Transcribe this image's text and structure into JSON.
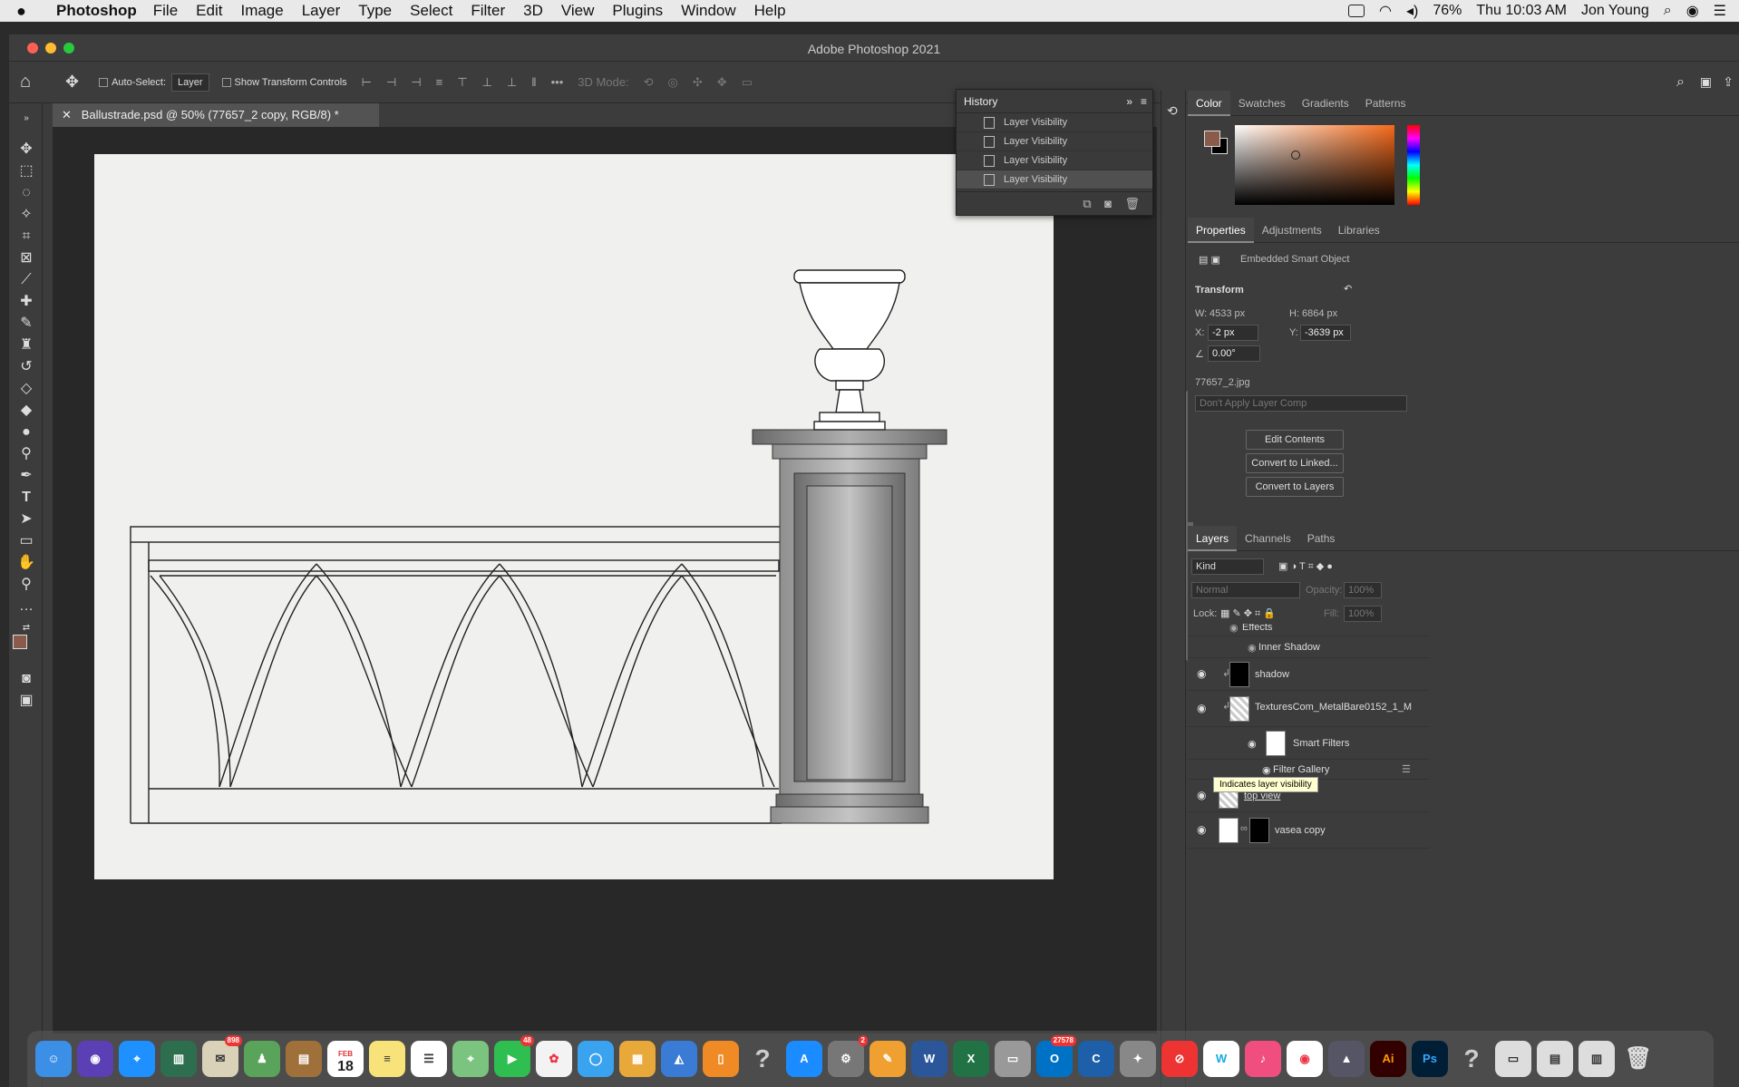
{
  "menubar": {
    "app_name": "Photoshop",
    "items": [
      "File",
      "Edit",
      "Image",
      "Layer",
      "Type",
      "Select",
      "Filter",
      "3D",
      "View",
      "Plugins",
      "Window",
      "Help"
    ],
    "battery": "76%",
    "clock": "Thu 10:03 AM",
    "user": "Jon Young"
  },
  "window": {
    "title": "Adobe Photoshop 2021"
  },
  "options": {
    "auto_select_label": "Auto-Select:",
    "auto_select_value": "Layer",
    "transform_label": "Show Transform Controls",
    "mode_label": "3D Mode:",
    "more": "•••"
  },
  "document": {
    "tab_title": "Ballustrade.psd @ 50% (77657_2 copy, RGB/8) *"
  },
  "history": {
    "title": "History",
    "items": [
      "Layer Visibility",
      "Layer Visibility",
      "Layer Visibility",
      "Layer Visibility"
    ]
  },
  "color_panel": {
    "tabs": [
      "Color",
      "Swatches",
      "Gradients",
      "Patterns"
    ],
    "foreground": "#8a5a4a",
    "background": "#000000"
  },
  "properties": {
    "tabs": [
      "Properties",
      "Adjustments",
      "Libraries"
    ],
    "type_label": "Embedded Smart Object",
    "transform_label": "Transform",
    "w_label": "W:",
    "w_value": "4533 px",
    "h_label": "H:",
    "h_value": "6864 px",
    "x_label": "X:",
    "x_value": "-2 px",
    "y_label": "Y:",
    "y_value": "-3639 px",
    "angle_value": "0.00°",
    "filename": "77657_2.jpg",
    "layer_comp": "Don't Apply Layer Comp",
    "buttons": [
      "Edit Contents",
      "Convert to Linked...",
      "Convert to Layers"
    ]
  },
  "layers_panel": {
    "tabs": [
      "Layers",
      "Channels",
      "Paths"
    ],
    "kind_label": "Kind",
    "blend_mode": "Normal",
    "opacity_label": "Opacity:",
    "opacity_value": "100%",
    "lock_label": "Lock:",
    "fill_label": "Fill:",
    "fill_value": "100%",
    "tooltip": "Indicates layer visibility",
    "rows": {
      "effects": "Effects",
      "inner_shadow": "Inner Shadow",
      "shadow": "shadow",
      "texture": "TexturesCom_MetalBare0152_1_M",
      "smart_filters": "Smart Filters",
      "filter_gallery": "Filter Gallery",
      "top_view": "top view",
      "vase_copy": "vasea copy"
    }
  },
  "dock": {
    "badges": {
      "mail": "898",
      "facetime": "48",
      "outlook": "27578"
    },
    "calendar": {
      "month": "FEB",
      "day": "18"
    }
  }
}
